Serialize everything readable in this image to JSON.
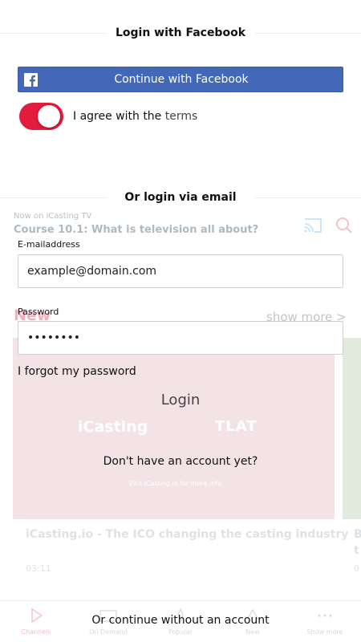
{
  "facebook_section": {
    "title": "Login with Facebook",
    "button_label": "Continue with Facebook",
    "brand_color": "#4468b8"
  },
  "terms": {
    "label_prefix": "I agree with the ",
    "label_link": "terms",
    "checked": true,
    "toggle_color": "#e31b3c"
  },
  "email_section": {
    "title": "Or login via email",
    "email_label": "E-mailaddress",
    "email_placeholder": "example@domain.com",
    "password_label": "Password",
    "password_value": "password",
    "forgot_label": "I forgot my password",
    "login_label": "Login",
    "signup_label": "Don't have an account yet?"
  },
  "continue_label": "Or continue without an account",
  "background": {
    "now_on": "Now on iCasting TV",
    "course_title": "Course 10.1: What is television all about?",
    "new_heading": "New",
    "show_more": "show more >",
    "card_logo_1": "iCasting",
    "card_logo_2": "TLAT",
    "card_visit": "Visit iCasting.io for more info",
    "card_title": "iCasting.io - The ICO changing the casting industry",
    "card_duration": "03:11",
    "card2_title_a": "B",
    "card2_title_b": "t",
    "card2_duration": "0",
    "nav": [
      {
        "label": "Channels",
        "icon": "play-icon"
      },
      {
        "label": "On Demand",
        "icon": "tv-icon"
      },
      {
        "label": "Popular",
        "icon": "popular-icon"
      },
      {
        "label": "New",
        "icon": "new-icon"
      },
      {
        "label": "Show more",
        "icon": "more-icon"
      }
    ]
  }
}
